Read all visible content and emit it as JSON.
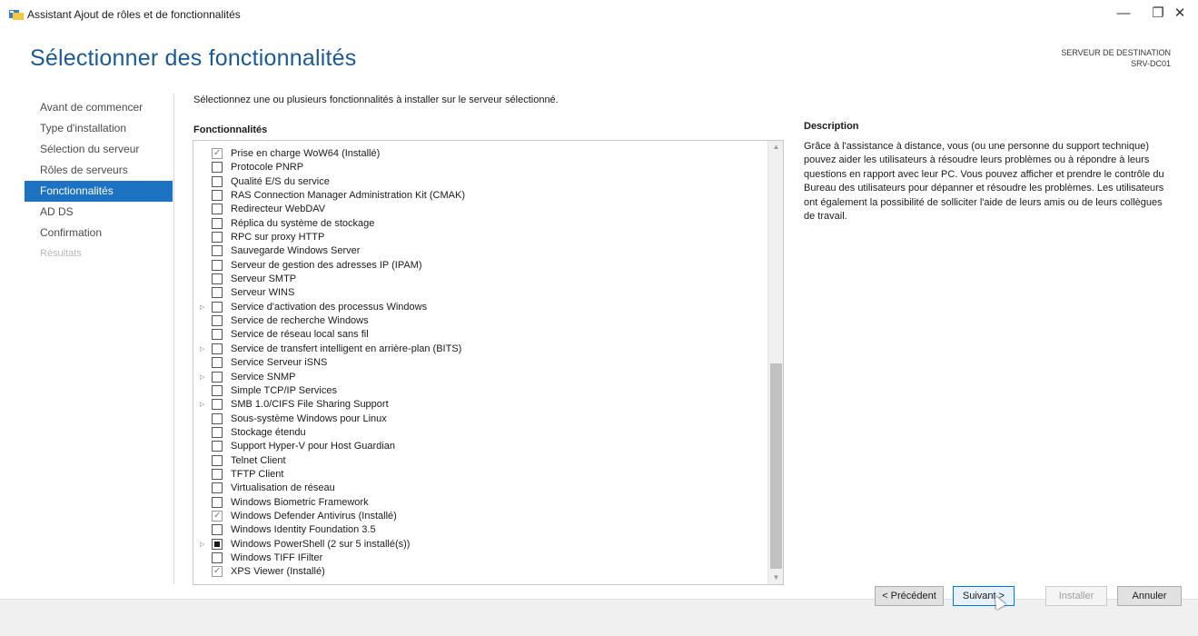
{
  "window": {
    "title": "Assistant Ajout de rôles et de fonctionnalités",
    "minimize_glyph": "—",
    "restore_glyph": "❐",
    "close_glyph": "✕"
  },
  "header": {
    "page_title": "Sélectionner des fonctionnalités",
    "destination_label": "SERVEUR DE DESTINATION",
    "destination_value": "SRV-DC01"
  },
  "nav": {
    "items": [
      {
        "label": "Avant de commencer",
        "state": "normal"
      },
      {
        "label": "Type d'installation",
        "state": "normal"
      },
      {
        "label": "Sélection du serveur",
        "state": "normal"
      },
      {
        "label": "Rôles de serveurs",
        "state": "normal"
      },
      {
        "label": "Fonctionnalités",
        "state": "active"
      },
      {
        "label": "AD DS",
        "state": "normal"
      },
      {
        "label": "Confirmation",
        "state": "normal"
      },
      {
        "label": "Résultats",
        "state": "disabled"
      }
    ]
  },
  "main": {
    "instruction": "Sélectionnez une ou plusieurs fonctionnalités à installer sur le serveur sélectionné.",
    "list_header": "Fonctionnalités",
    "features": [
      {
        "label": "Prise en charge WoW64 (Installé)",
        "state": "checked",
        "expandable": false
      },
      {
        "label": "Protocole PNRP",
        "state": "unchecked",
        "expandable": false
      },
      {
        "label": "Qualité E/S du service",
        "state": "unchecked",
        "expandable": false
      },
      {
        "label": "RAS Connection Manager Administration Kit (CMAK)",
        "state": "unchecked",
        "expandable": false
      },
      {
        "label": "Redirecteur WebDAV",
        "state": "unchecked",
        "expandable": false
      },
      {
        "label": "Réplica du système de stockage",
        "state": "unchecked",
        "expandable": false
      },
      {
        "label": "RPC sur proxy HTTP",
        "state": "unchecked",
        "expandable": false
      },
      {
        "label": "Sauvegarde Windows Server",
        "state": "unchecked",
        "expandable": false
      },
      {
        "label": "Serveur de gestion des adresses IP (IPAM)",
        "state": "unchecked",
        "expandable": false
      },
      {
        "label": "Serveur SMTP",
        "state": "unchecked",
        "expandable": false
      },
      {
        "label": "Serveur WINS",
        "state": "unchecked",
        "expandable": false
      },
      {
        "label": "Service d'activation des processus Windows",
        "state": "unchecked",
        "expandable": true
      },
      {
        "label": "Service de recherche Windows",
        "state": "unchecked",
        "expandable": false
      },
      {
        "label": "Service de réseau local sans fil",
        "state": "unchecked",
        "expandable": false
      },
      {
        "label": "Service de transfert intelligent en arrière-plan (BITS)",
        "state": "unchecked",
        "expandable": true
      },
      {
        "label": "Service Serveur iSNS",
        "state": "unchecked",
        "expandable": false
      },
      {
        "label": "Service SNMP",
        "state": "unchecked",
        "expandable": true
      },
      {
        "label": "Simple TCP/IP Services",
        "state": "unchecked",
        "expandable": false
      },
      {
        "label": "SMB 1.0/CIFS File Sharing Support",
        "state": "unchecked",
        "expandable": true
      },
      {
        "label": "Sous-système Windows pour Linux",
        "state": "unchecked",
        "expandable": false
      },
      {
        "label": "Stockage étendu",
        "state": "unchecked",
        "expandable": false
      },
      {
        "label": "Support Hyper-V pour Host Guardian",
        "state": "unchecked",
        "expandable": false
      },
      {
        "label": "Telnet Client",
        "state": "unchecked",
        "expandable": false
      },
      {
        "label": "TFTP Client",
        "state": "unchecked",
        "expandable": false
      },
      {
        "label": "Virtualisation de réseau",
        "state": "unchecked",
        "expandable": false
      },
      {
        "label": "Windows Biometric Framework",
        "state": "unchecked",
        "expandable": false
      },
      {
        "label": "Windows Defender Antivirus (Installé)",
        "state": "checked",
        "expandable": false
      },
      {
        "label": "Windows Identity Foundation 3.5",
        "state": "unchecked",
        "expandable": false
      },
      {
        "label": "Windows PowerShell (2 sur 5 installé(s))",
        "state": "partial",
        "expandable": true
      },
      {
        "label": "Windows TIFF IFilter",
        "state": "unchecked",
        "expandable": false
      },
      {
        "label": "XPS Viewer (Installé)",
        "state": "checked",
        "expandable": false
      }
    ],
    "scroll_position": 0.92
  },
  "description": {
    "header": "Description",
    "text": "Grâce à l'assistance à distance, vous (ou une personne du support technique) pouvez aider les utilisateurs à résoudre leurs problèmes ou à répondre à leurs questions en rapport avec leur PC. Vous pouvez afficher et prendre le contrôle du Bureau des utilisateurs pour dépanner et résoudre les problèmes. Les utilisateurs ont également la possibilité de solliciter l'aide de leurs amis ou de leurs collègues de travail."
  },
  "footer": {
    "previous_label": "< Précédent",
    "next_label": "Suivant >",
    "install_label": "Installer",
    "cancel_label": "Annuler"
  },
  "icons": {
    "expander": "expand-arrow-icon",
    "checkbox": "checkbox-icon"
  },
  "colors": {
    "accent": "#1d72c2",
    "title": "#1d5a94"
  }
}
